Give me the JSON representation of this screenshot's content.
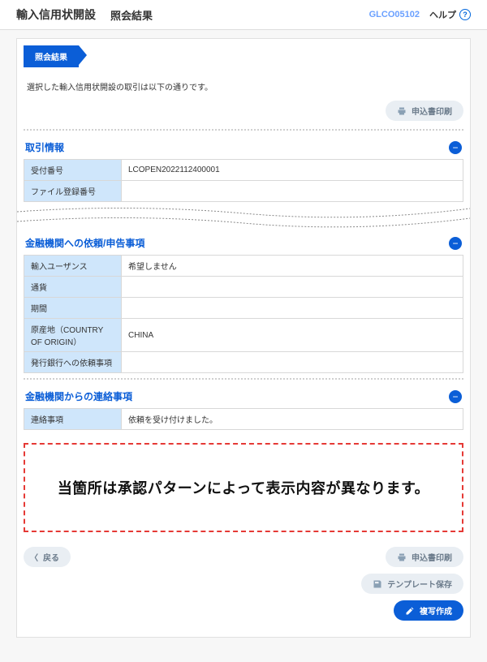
{
  "header": {
    "title": "輸入信用状開設",
    "subtitle": "照会結果",
    "code": "GLCO05102",
    "help": "ヘルプ"
  },
  "tab": {
    "label": "照会結果"
  },
  "intro": "選択した輸入信用状開設の取引は以下の通りです。",
  "buttons": {
    "print": "申込書印刷",
    "back": "戻る",
    "template": "テンプレート保存",
    "copy": "複写作成"
  },
  "sections": {
    "transaction": {
      "title": "取引情報",
      "rows": {
        "receiptNo": {
          "label": "受付番号",
          "value": "LCOPEN2022112400001"
        },
        "fileReg": {
          "label": "ファイル登録番号",
          "value": ""
        }
      }
    },
    "request": {
      "title": "金融機関への依頼/申告事項",
      "rows": {
        "insurance": {
          "label": "輸入ユーザンス",
          "value": "希望しません"
        },
        "currency": {
          "label": "通貨",
          "value": ""
        },
        "period": {
          "label": "期間",
          "value": ""
        },
        "origin": {
          "label": "原産地（COUNTRY OF ORIGIN）",
          "value": "CHINA"
        },
        "bankReq": {
          "label": "発行銀行への依頼事項",
          "value": ""
        }
      }
    },
    "contact": {
      "title": "金融機関からの連絡事項",
      "rows": {
        "note": {
          "label": "連絡事項",
          "value": "依頼を受け付けました。"
        }
      }
    }
  },
  "notice": "当箇所は承認パターンによって表示内容が異なります。"
}
